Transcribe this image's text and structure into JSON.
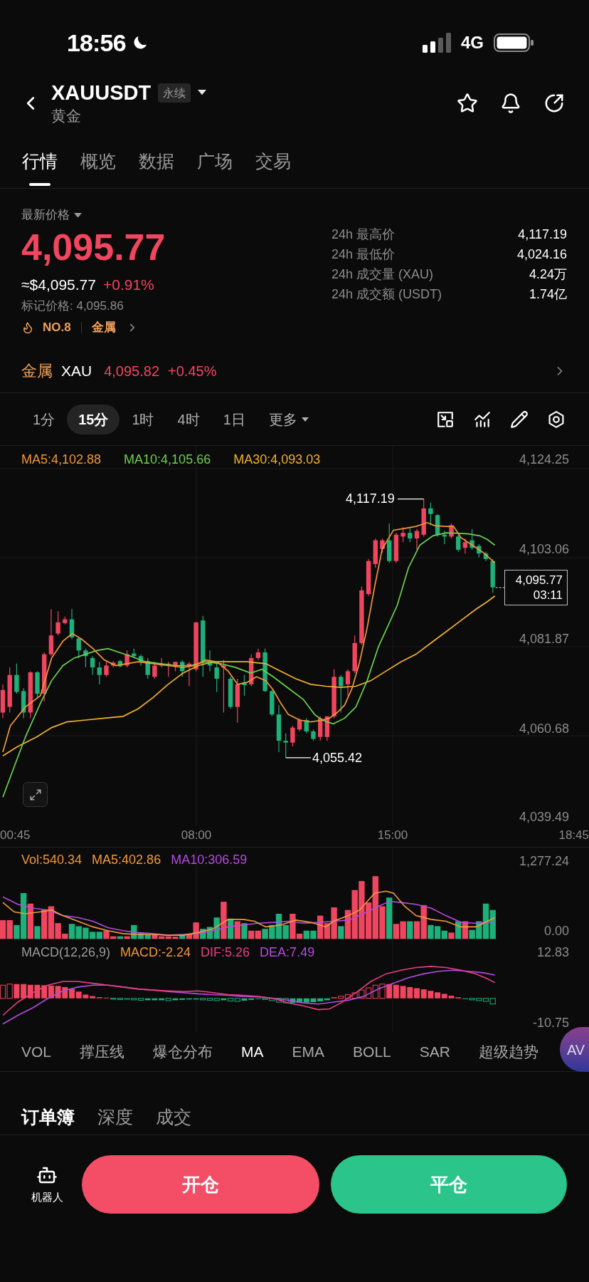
{
  "status_bar": {
    "time": "18:56",
    "network": "4G"
  },
  "header": {
    "symbol": "XAUUSDT",
    "badge": "永续",
    "subtitle": "黄金"
  },
  "tabs": [
    {
      "label": "行情",
      "selected": true
    },
    {
      "label": "概览",
      "selected": false
    },
    {
      "label": "数据",
      "selected": false
    },
    {
      "label": "广场",
      "selected": false
    },
    {
      "label": "交易",
      "selected": false
    }
  ],
  "price": {
    "label": "最新价格",
    "last": "4,095.77",
    "approx": "≈$4,095.77",
    "change": "+0.91%",
    "mark": "标记价格: 4,095.86",
    "rank": "NO.8",
    "category": "金属"
  },
  "stats": [
    {
      "label": "24h 最高价",
      "value": "4,117.19"
    },
    {
      "label": "24h 最低价",
      "value": "4,024.16"
    },
    {
      "label": "24h 成交量 (XAU)",
      "value": "4.24万"
    },
    {
      "label": "24h 成交额 (USDT)",
      "value": "1.74亿"
    }
  ],
  "index": {
    "category": "金属",
    "symbol": "XAU",
    "price": "4,095.82",
    "change": "+0.45%"
  },
  "intervals": [
    {
      "label": "1分",
      "selected": false
    },
    {
      "label": "15分",
      "selected": true
    },
    {
      "label": "1时",
      "selected": false
    },
    {
      "label": "4时",
      "selected": false
    },
    {
      "label": "1日",
      "selected": false
    }
  ],
  "more": "更多",
  "chart": {
    "legend": [
      {
        "label": "MA5:4,102.88",
        "color": "#f0963a"
      },
      {
        "label": "MA10:4,105.66",
        "color": "#6cd14f"
      },
      {
        "label": "MA30:4,093.03",
        "color": "#f2b12e"
      }
    ],
    "y_labels": [
      "4,124.25",
      "4,103.06",
      "4,081.87",
      "4,060.68",
      "4,039.49"
    ],
    "x_labels": [
      "00:45",
      "08:00",
      "15:00",
      "18:45"
    ],
    "high": "4,117.19",
    "low": "4,055.42",
    "tag": {
      "price": "4,095.77",
      "countdown": "03:11"
    }
  },
  "volume": {
    "legend": [
      {
        "label": "Vol:540.34",
        "color": "#f0963a"
      },
      {
        "label": "MA5:402.86",
        "color": "#f29a3c"
      },
      {
        "label": "MA10:306.59",
        "color": "#b44be1"
      }
    ],
    "y_labels": [
      "1,277.24",
      "0.00"
    ]
  },
  "macd": {
    "legend": [
      {
        "label": "MACD(12,26,9)",
        "color": "#9a9a9a"
      },
      {
        "label": "MACD:-2.24",
        "color": "#f0963a"
      },
      {
        "label": "DIF:5.26",
        "color": "#e8407f"
      },
      {
        "label": "DEA:7.49",
        "color": "#b44be1"
      }
    ],
    "y_labels": [
      "12.83",
      "-10.75"
    ]
  },
  "indicators": [
    {
      "label": "VOL",
      "selected": false
    },
    {
      "label": "撑压线",
      "selected": false
    },
    {
      "label": "爆仓分布",
      "selected": false
    },
    {
      "label": "MA",
      "selected": true
    },
    {
      "label": "EMA",
      "selected": false
    },
    {
      "label": "BOLL",
      "selected": false
    },
    {
      "label": "SAR",
      "selected": false
    },
    {
      "label": "超级趋势",
      "selected": false
    }
  ],
  "floating_button": {
    "label": "AV"
  },
  "book_tabs": [
    {
      "label": "订单簿",
      "selected": true
    },
    {
      "label": "深度",
      "selected": false
    },
    {
      "label": "成交",
      "selected": false
    }
  ],
  "actions": {
    "bot": "机器人",
    "open": "开仓",
    "close": "平仓"
  }
}
